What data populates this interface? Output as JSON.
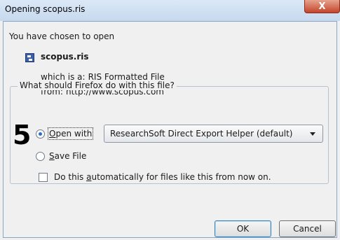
{
  "window": {
    "title": "Opening scopus.ris",
    "close_label": "X"
  },
  "intro_text": "You have chosen to open",
  "file": {
    "icon": "ris-file-icon",
    "name": "scopus.ris",
    "type_label": "which is a:",
    "type_value": "RIS Formatted File",
    "from_label": "from:",
    "from_value": "http://www.scopus.com"
  },
  "action_group": {
    "legend": "What should Firefox do with this file?",
    "step_number": "5",
    "open_with": {
      "label_pre": "",
      "label_key": "O",
      "label_post": "pen with",
      "checked": true
    },
    "application_select": {
      "value": "ResearchSoft Direct Export Helper (default)"
    },
    "save_file": {
      "label_key": "S",
      "label_post": "ave File",
      "checked": false
    }
  },
  "auto_checkbox": {
    "label_pre": "Do this ",
    "label_key": "a",
    "label_post": "utomatically for files like this from now on.",
    "checked": false
  },
  "buttons": {
    "ok": "OK",
    "cancel": "Cancel"
  },
  "colors": {
    "accent": "#2d6bd3",
    "close": "#c4442a"
  }
}
